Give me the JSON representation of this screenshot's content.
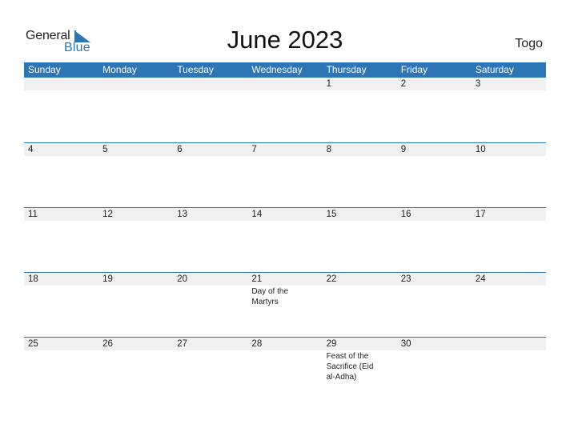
{
  "logo": {
    "line1": "General",
    "line2": "Blue",
    "brand_color": "#2e75b6"
  },
  "title": "June 2023",
  "country": "Togo",
  "header_color": "#2e75b6",
  "weekdays": [
    "Sunday",
    "Monday",
    "Tuesday",
    "Wednesday",
    "Thursday",
    "Friday",
    "Saturday"
  ],
  "weeks": [
    {
      "days": [
        "",
        "",
        "",
        "",
        "1",
        "2",
        "3"
      ],
      "events": [
        "",
        "",
        "",
        "",
        "",
        "",
        ""
      ]
    },
    {
      "days": [
        "4",
        "5",
        "6",
        "7",
        "8",
        "9",
        "10"
      ],
      "events": [
        "",
        "",
        "",
        "",
        "",
        "",
        ""
      ]
    },
    {
      "days": [
        "11",
        "12",
        "13",
        "14",
        "15",
        "16",
        "17"
      ],
      "events": [
        "",
        "",
        "",
        "",
        "",
        "",
        ""
      ]
    },
    {
      "days": [
        "18",
        "19",
        "20",
        "21",
        "22",
        "23",
        "24"
      ],
      "events": [
        "",
        "",
        "",
        "Day of the Martyrs",
        "",
        "",
        ""
      ]
    },
    {
      "days": [
        "25",
        "26",
        "27",
        "28",
        "29",
        "30",
        ""
      ],
      "events": [
        "",
        "",
        "",
        "",
        "Feast of the Sacrifice (Eid al-Adha)",
        "",
        ""
      ]
    }
  ]
}
